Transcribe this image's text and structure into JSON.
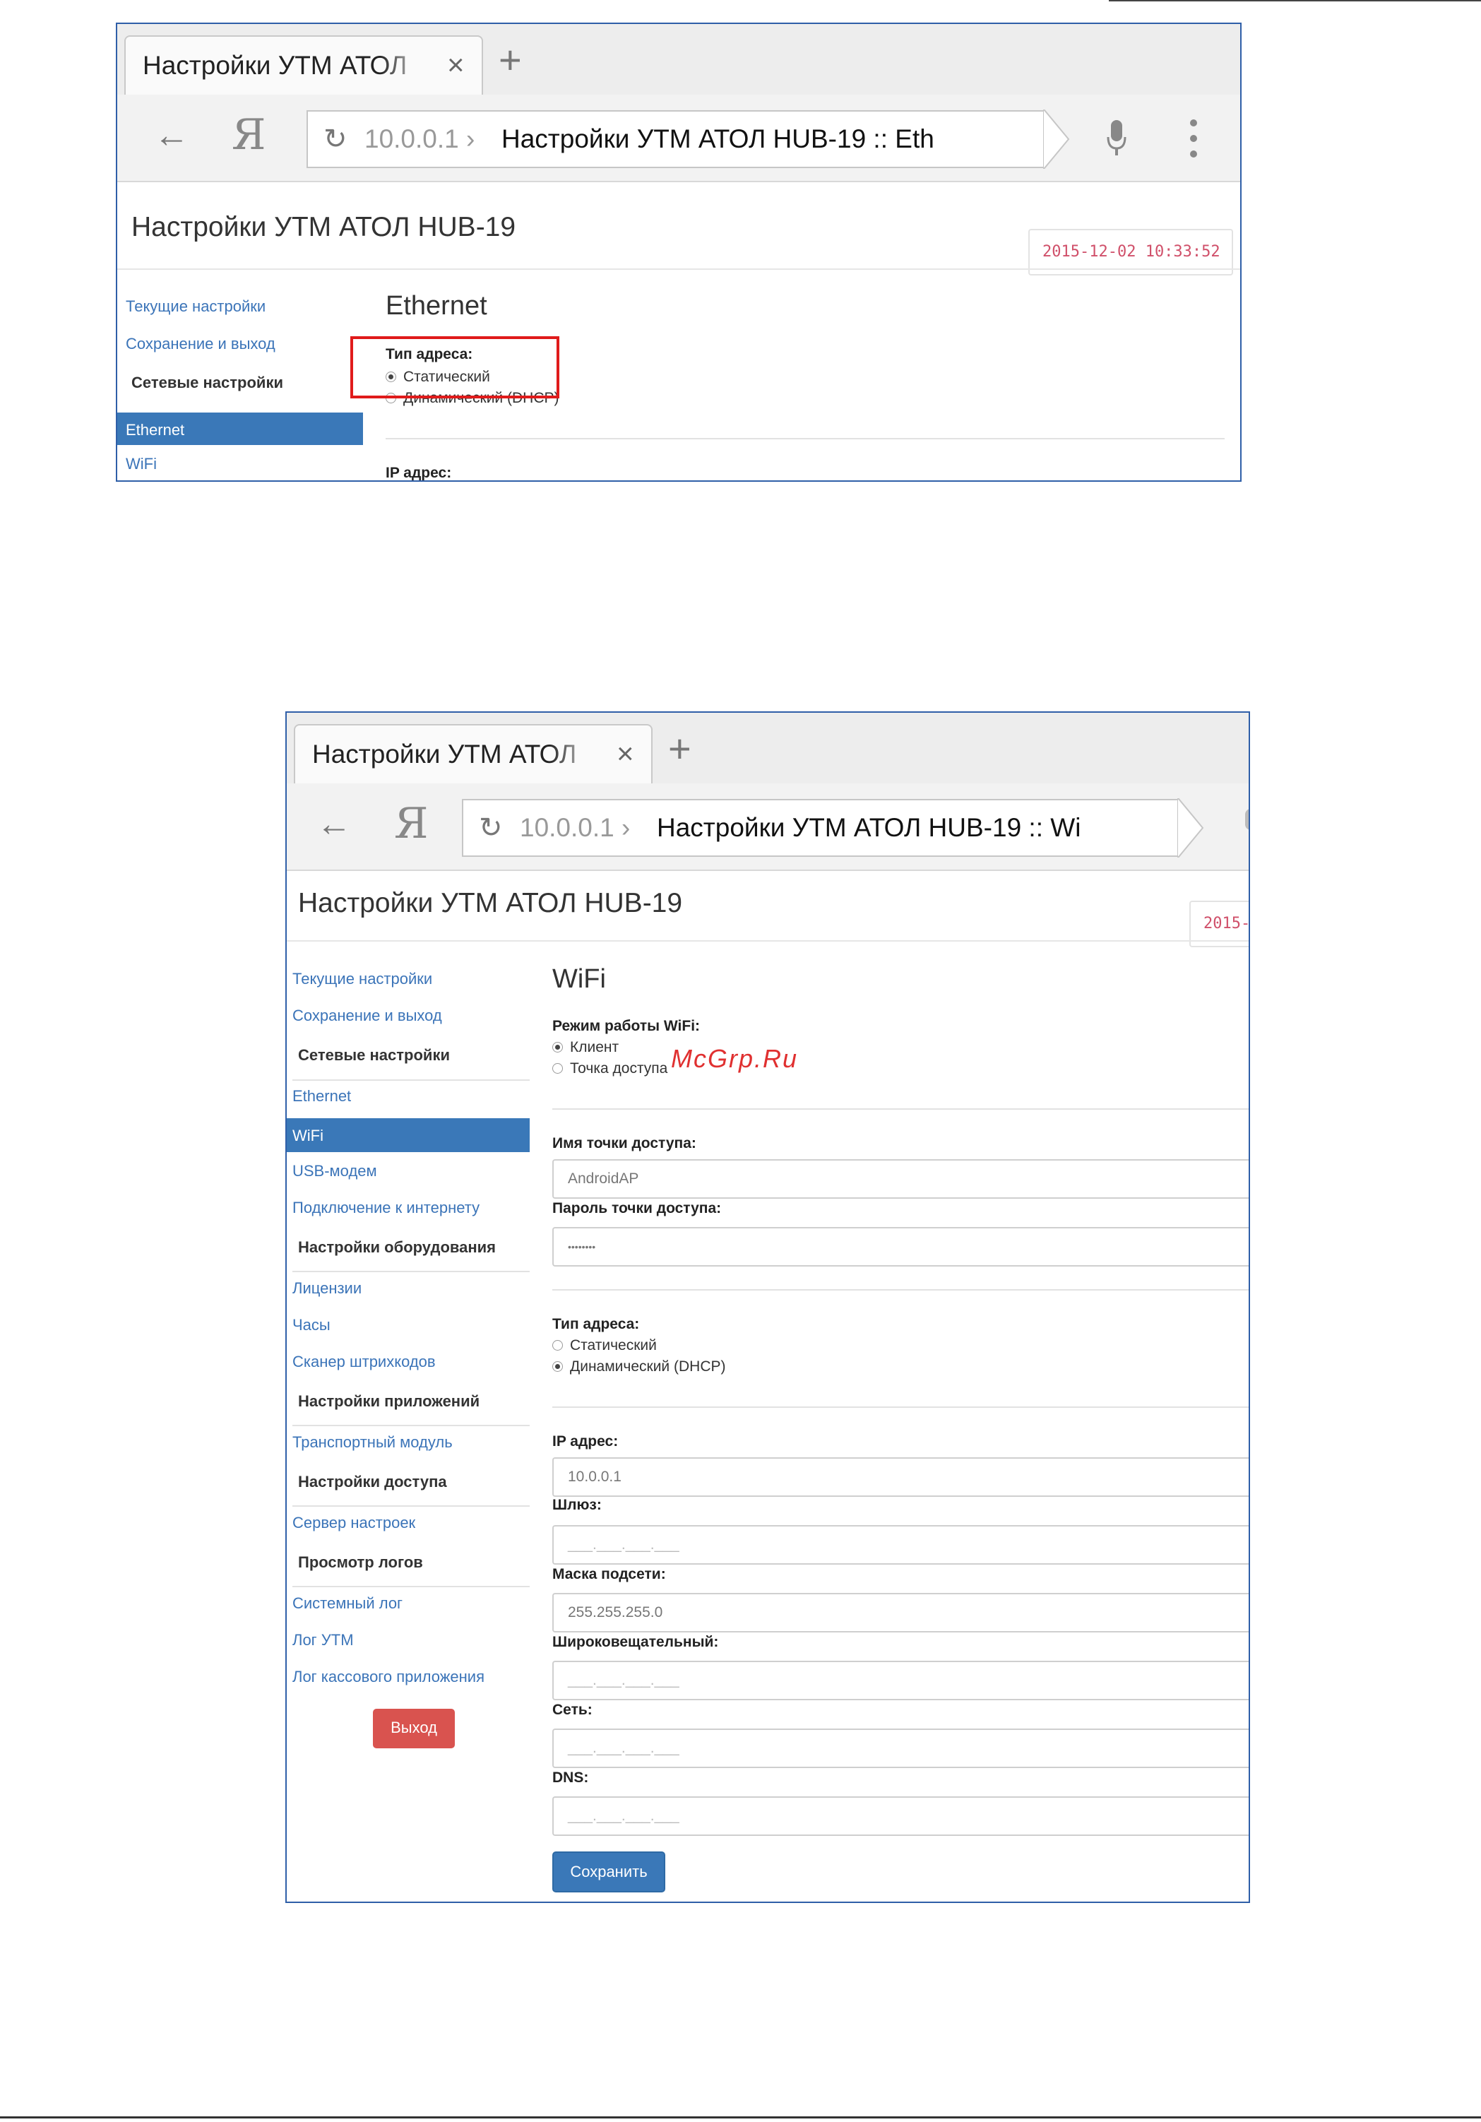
{
  "browser1": {
    "tab_title": "Настройки УТМ АТОЛ",
    "tab_close": "×",
    "new_tab": "+",
    "url_host": "10.0.0.1",
    "url_separator": "›",
    "url_title": "Настройки УТМ АТОЛ HUB-19 :: Eth"
  },
  "browser2": {
    "tab_title": "Настройки УТМ АТОЛ",
    "tab_close": "×",
    "new_tab": "+",
    "url_host": "10.0.0.1",
    "url_separator": "›",
    "url_title": "Настройки УТМ АТОЛ HUB-19 :: Wi"
  },
  "page": {
    "title": "Настройки УТМ АТОЛ HUB-19",
    "timestamp": "2015-12-02 10:33:52",
    "timestamp_partial": "2015-"
  },
  "sidebar1": {
    "current_settings": "Текущие настройки",
    "save_exit": "Сохранение и выход",
    "network_head": "Сетевые настройки",
    "ethernet": "Ethernet",
    "wifi": "WiFi"
  },
  "content1": {
    "section": "Ethernet",
    "addr_type_label": "Тип адреса:",
    "static": "Статический",
    "dynamic": "Динамический (DHCP)",
    "ip_label": "IP адрес:"
  },
  "sidebar2": {
    "current_settings": "Текущие настройки",
    "save_exit": "Сохранение и выход",
    "network_head": "Сетевые настройки",
    "ethernet": "Ethernet",
    "wifi": "WiFi",
    "usb_modem": "USB-модем",
    "internet": "Подключение к интернету",
    "hardware_head": "Настройки оборудования",
    "licenses": "Лицензии",
    "clock": "Часы",
    "scanner": "Сканер штрихкодов",
    "apps_head": "Настройки приложений",
    "transport": "Транспортный модуль",
    "access_head": "Настройки доступа",
    "settings_server": "Сервер настроек",
    "logs_head": "Просмотр логов",
    "system_log": "Системный лог",
    "utm_log": "Лог УТМ",
    "cash_log": "Лог кассового приложения",
    "exit_button": "Выход"
  },
  "content2": {
    "section": "WiFi",
    "mode_label": "Режим работы WiFi:",
    "client": "Клиент",
    "access_point": "Точка доступа",
    "ap_name_label": "Имя точки доступа:",
    "ap_name_value": "AndroidAP",
    "ap_pass_label": "Пароль точки доступа:",
    "ap_pass_value": "••••••••",
    "addr_type_label": "Тип адреса:",
    "static": "Статический",
    "dynamic": "Динамический (DHCP)",
    "ip_label": "IP адрес:",
    "ip_value": "10.0.0.1",
    "gateway_label": "Шлюз:",
    "gateway_value": "___.___.___.___",
    "mask_label": "Маска подсети:",
    "mask_value": "255.255.255.0",
    "broadcast_label": "Широковещательный:",
    "broadcast_value": "___.___.___.___",
    "network_label": "Сеть:",
    "network_value": "___.___.___.___",
    "dns_label": "DNS:",
    "dns_value": "___.___.___.___",
    "save_button": "Сохранить"
  },
  "watermark": "McGrp.Ru",
  "colors": {
    "link": "#3b74b8",
    "active_nav": "#3a78b8",
    "highlight_box": "#e01b1b",
    "exit_button": "#d9534f",
    "timestamp": "#d0506a"
  }
}
